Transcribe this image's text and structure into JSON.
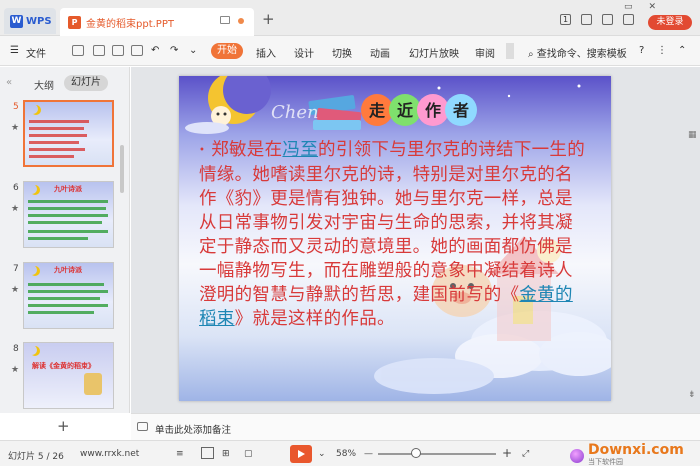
{
  "titlebar": {
    "app_label": "WPS",
    "doc_tab": "金黄的稻束ppt.PPT",
    "new_tab": "+",
    "unsaved_label": "未登录",
    "page_badge": "1"
  },
  "menubar": {
    "file": "文件",
    "items": [
      "开始",
      "插入",
      "设计",
      "切换",
      "动画",
      "幻灯片放映",
      "审阅"
    ],
    "search": "查找命令、搜索模板",
    "help": "?"
  },
  "panel": {
    "outline_tab": "大纲",
    "slides_tab": "幻灯片",
    "collapse": "«",
    "slides": [
      {
        "num": "5",
        "title": ""
      },
      {
        "num": "6",
        "title": "九叶诗派"
      },
      {
        "num": "7",
        "title": "九叶诗派"
      },
      {
        "num": "8",
        "title": "解读《金黄的稻束》"
      }
    ],
    "add_slide": "+"
  },
  "slide": {
    "title_chars": [
      "走",
      "近",
      "作",
      "者"
    ],
    "cursive": "Chen",
    "body_pre": "郑敏是在",
    "link1": "冯至",
    "body_mid": "的引领下与里尔克的诗结下一生的情缘。她嗜读里尔克的诗，特别是对里尔克的名作《豹》更是情有独钟。她与里尔克一样，总是从日常事物引发对宇宙与生命的思索，并将其凝定于静态而又灵动的意境里。她的画面都仿佛是一幅静物写生，而在雕塑般的意象中凝结着诗人澄明的智慧与静默的哲思，建国前写的《",
    "link2": "金黄的稻束",
    "body_post": "》就是这样的作品。"
  },
  "notes": {
    "placeholder": "单击此处添加备注"
  },
  "status": {
    "slide_counter": "幻灯片 5 / 26",
    "site": "www.rrxk.net",
    "zoom": "58%",
    "minus": "—",
    "plus": "+"
  },
  "watermark": {
    "brand": "Downxi.com",
    "sub": "当下软件园"
  },
  "colors": {
    "accent": "#f07438",
    "body_text": "#d83a3a",
    "link": "#1e86b4"
  }
}
